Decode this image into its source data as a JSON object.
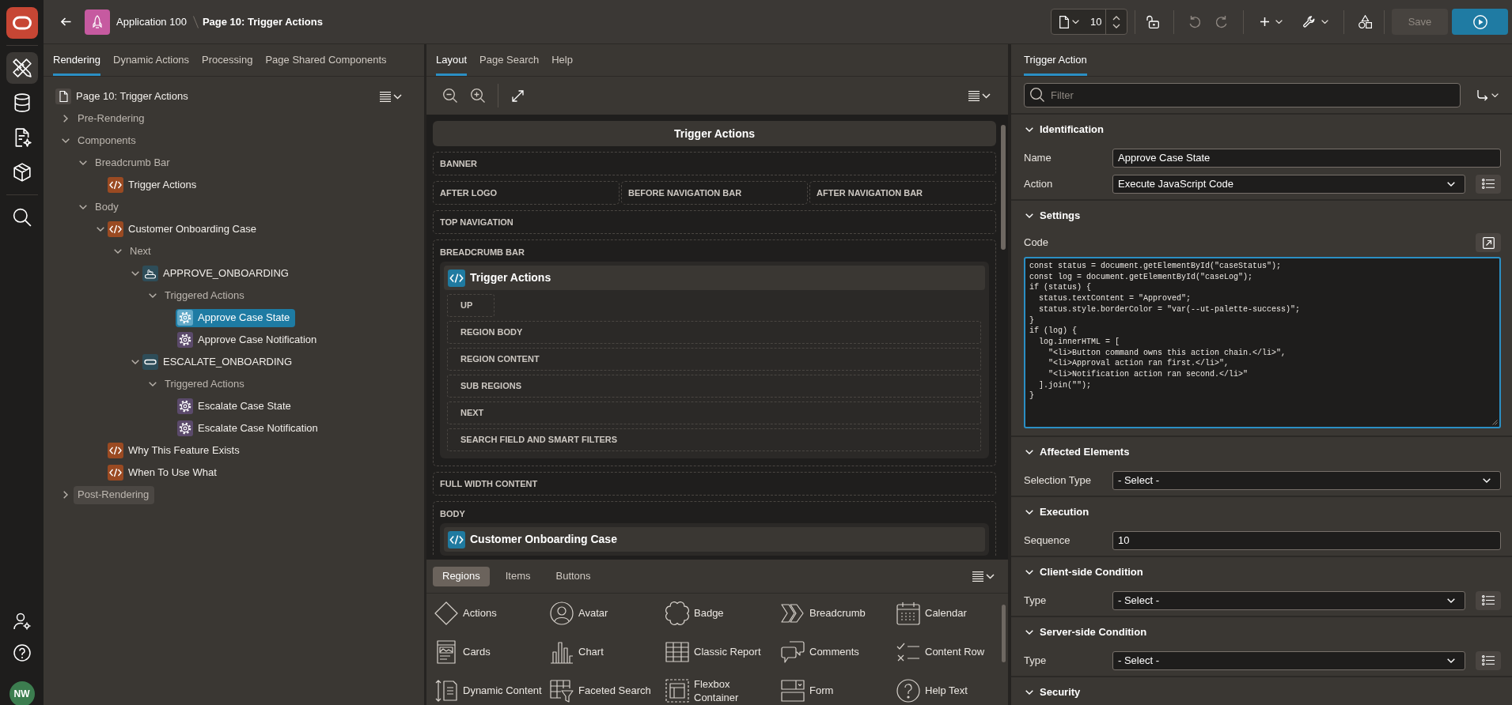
{
  "header": {
    "application": "Application 100",
    "page": "Page 10: Trigger Actions",
    "page_number": "10",
    "undo": {
      "disabled": true
    },
    "redo": {
      "disabled": true
    },
    "save": {
      "label": "Save",
      "disabled": true
    }
  },
  "nav_rail": {
    "items": [
      {
        "selected": true
      },
      {
        "selected": false
      },
      {
        "selected": false
      },
      {
        "selected": false
      },
      {
        "selected": false
      }
    ],
    "avatar": "NW"
  },
  "rendering_panel": {
    "tabs": [
      {
        "label": "Rendering",
        "selected": true
      },
      {
        "label": "Dynamic Actions",
        "selected": false
      },
      {
        "label": "Processing",
        "selected": false
      },
      {
        "label": "Page Shared Components",
        "selected": false
      }
    ],
    "tree": {
      "label": "Page 10: Trigger Actions",
      "kind": "page",
      "selected": false,
      "hovered": false,
      "children": [
        {
          "label": "Pre-Rendering",
          "kind": "group",
          "expanded": false,
          "selected": false,
          "hovered": false
        },
        {
          "label": "Components",
          "kind": "group",
          "expanded": true,
          "selected": false,
          "hovered": false,
          "children": [
            {
              "label": "Breadcrumb Bar",
              "kind": "group",
              "expanded": true,
              "selected": false,
              "hovered": false,
              "children": [
                {
                  "label": "Trigger Actions",
                  "kind": "region",
                  "selected": false,
                  "hovered": false
                }
              ]
            },
            {
              "label": "Body",
              "kind": "group",
              "expanded": true,
              "selected": false,
              "hovered": false,
              "children": [
                {
                  "label": "Customer Onboarding Case",
                  "kind": "region",
                  "expanded": true,
                  "selected": false,
                  "hovered": false,
                  "children": [
                    {
                      "label": "Next",
                      "kind": "group",
                      "expanded": true,
                      "selected": false,
                      "hovered": false,
                      "children": [
                        {
                          "label": "APPROVE_ONBOARDING",
                          "kind": "pressbutton",
                          "expanded": true,
                          "selected": false,
                          "hovered": false,
                          "children": [
                            {
                              "label": "Triggered Actions",
                              "kind": "group",
                              "expanded": true,
                              "selected": false,
                              "hovered": false,
                              "children": [
                                {
                                  "label": "Approve Case State",
                                  "kind": "action",
                                  "selected": true,
                                  "hovered": false
                                },
                                {
                                  "label": "Approve Case Notification",
                                  "kind": "action",
                                  "selected": false,
                                  "hovered": false
                                }
                              ]
                            }
                          ]
                        },
                        {
                          "label": "ESCALATE_ONBOARDING",
                          "kind": "button",
                          "expanded": true,
                          "selected": false,
                          "hovered": false,
                          "children": [
                            {
                              "label": "Triggered Actions",
                              "kind": "group",
                              "expanded": true,
                              "selected": false,
                              "hovered": false,
                              "children": [
                                {
                                  "label": "Escalate Case State",
                                  "kind": "action",
                                  "selected": false,
                                  "hovered": false
                                },
                                {
                                  "label": "Escalate Case Notification",
                                  "kind": "action",
                                  "selected": false,
                                  "hovered": false
                                }
                              ]
                            }
                          ]
                        }
                      ]
                    }
                  ]
                },
                {
                  "label": "Why This Feature Exists",
                  "kind": "region",
                  "selected": false,
                  "hovered": false
                },
                {
                  "label": "When To Use What",
                  "kind": "region",
                  "selected": false,
                  "hovered": false
                }
              ]
            }
          ]
        },
        {
          "label": "Post-Rendering",
          "kind": "group",
          "expanded": false,
          "selected": false,
          "hovered": true
        }
      ]
    }
  },
  "layout_panel": {
    "tabs": [
      {
        "label": "Layout",
        "selected": true
      },
      {
        "label": "Page Search",
        "selected": false
      },
      {
        "label": "Help",
        "selected": false
      }
    ],
    "canvas": {
      "title": "Trigger Actions",
      "positions": [
        {
          "kind": "slot",
          "label": "BANNER"
        },
        {
          "kind": "row",
          "slots": [
            {
              "label": "AFTER LOGO"
            },
            {
              "label": "BEFORE NAVIGATION BAR"
            },
            {
              "label": "AFTER NAVIGATION BAR"
            }
          ]
        },
        {
          "kind": "slot",
          "label": "TOP NAVIGATION"
        },
        {
          "kind": "slot",
          "label": "BREADCRUMB BAR",
          "regions": [
            {
              "title": "Trigger Actions",
              "slots": [
                {
                  "label": "UP",
                  "kind": "compact"
                },
                {
                  "label": "REGION BODY",
                  "kind": "wide"
                },
                {
                  "label": "REGION CONTENT",
                  "kind": "wide"
                },
                {
                  "label": "SUB REGIONS",
                  "kind": "wide"
                },
                {
                  "label": "NEXT",
                  "kind": "wide"
                },
                {
                  "label": "SEARCH FIELD AND SMART FILTERS",
                  "kind": "wide"
                }
              ]
            }
          ]
        },
        {
          "kind": "slot",
          "label": "FULL WIDTH CONTENT"
        },
        {
          "kind": "slot",
          "label": "BODY",
          "regions": [
            {
              "title": "Customer Onboarding Case"
            }
          ]
        }
      ]
    }
  },
  "gallery": {
    "tabs": [
      {
        "label": "Regions",
        "selected": true
      },
      {
        "label": "Items",
        "selected": false
      },
      {
        "label": "Buttons",
        "selected": false
      }
    ],
    "items": [
      "Actions",
      "Avatar",
      "Badge",
      "Breadcrumb",
      "Calendar",
      "Cards",
      "Chart",
      "Classic Report",
      "Comments",
      "Content Row",
      "Dynamic Content",
      "Faceted Search",
      "Flexbox Container",
      "Form",
      "Help Text"
    ]
  },
  "property_editor": {
    "tabs": [
      {
        "label": "Trigger Action",
        "selected": true
      }
    ],
    "filter": {
      "placeholder": "Filter"
    },
    "sections": [
      {
        "title": "Identification",
        "expanded": true,
        "fields": [
          {
            "label": "Name",
            "kind": "text",
            "value": "Approve Case State"
          },
          {
            "label": "Action",
            "kind": "select",
            "value": "Execute JavaScript Code",
            "list_button": true
          }
        ]
      },
      {
        "title": "Settings",
        "expanded": true,
        "fields": [
          {
            "label": "Code",
            "kind": "code",
            "value": "const status = document.getElementById(\"caseStatus\");\nconst log = document.getElementById(\"caseLog\");\nif (status) {\n  status.textContent = \"Approved\";\n  status.style.borderColor = \"var(--ut-palette-success)\";\n}\nif (log) {\n  log.innerHTML = [\n    \"<li>Button command owns this action chain.</li>\",\n    \"<li>Approval action ran first.</li>\",\n    \"<li>Notification action ran second.</li>\"\n  ].join(\"\");\n}"
          }
        ]
      },
      {
        "title": "Affected Elements",
        "expanded": true,
        "fields": [
          {
            "label": "Selection Type",
            "kind": "select",
            "value": "- Select -",
            "list_button": false
          }
        ]
      },
      {
        "title": "Execution",
        "expanded": true,
        "fields": [
          {
            "label": "Sequence",
            "kind": "text",
            "value": "10"
          }
        ]
      },
      {
        "title": "Client-side Condition",
        "expanded": true,
        "fields": [
          {
            "label": "Type",
            "kind": "select",
            "value": "- Select -",
            "list_button": true
          }
        ]
      },
      {
        "title": "Server-side Condition",
        "expanded": true,
        "fields": [
          {
            "label": "Type",
            "kind": "select",
            "value": "- Select -",
            "list_button": true
          }
        ]
      },
      {
        "title": "Security",
        "expanded": true
      }
    ]
  }
}
